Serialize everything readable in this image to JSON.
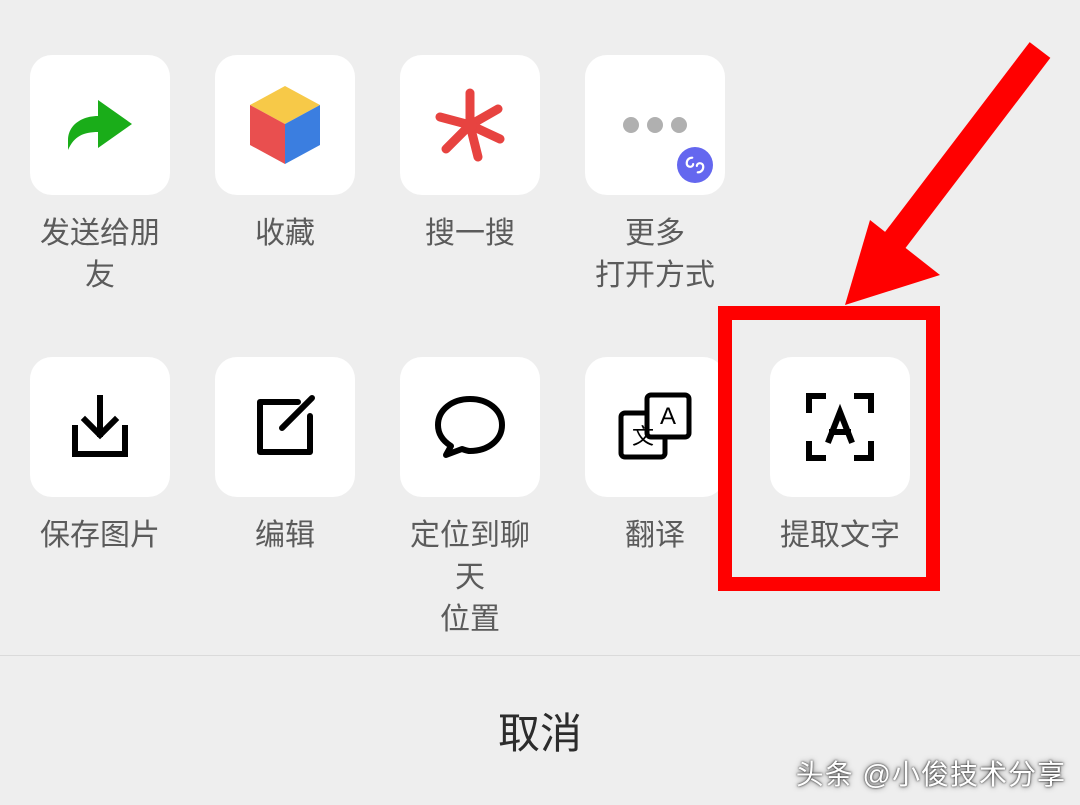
{
  "row1": [
    {
      "id": "send-to-friend",
      "label": "发送给朋友",
      "icon": "share"
    },
    {
      "id": "favorite",
      "label": "收藏",
      "icon": "cube"
    },
    {
      "id": "search",
      "label": "搜一搜",
      "icon": "spark"
    },
    {
      "id": "more-open",
      "label": "更多\n打开方式",
      "icon": "more"
    }
  ],
  "row2": [
    {
      "id": "save-image",
      "label": "保存图片",
      "icon": "download"
    },
    {
      "id": "edit",
      "label": "编辑",
      "icon": "edit"
    },
    {
      "id": "locate-chat",
      "label": "定位到聊天\n位置",
      "icon": "chat"
    },
    {
      "id": "translate",
      "label": "翻译",
      "icon": "translate"
    },
    {
      "id": "extract-text",
      "label": "提取文字",
      "icon": "ocr"
    }
  ],
  "cancel_label": "取消",
  "watermark_text": "头条 @小俊技术分享",
  "colors": {
    "accent_green": "#1aad19",
    "cube_red": "#e94f4f",
    "cube_blue": "#3b7ee0",
    "cube_yellow": "#f7c948",
    "spark_red": "#e74340",
    "badge_purple": "#6467ef",
    "highlight_red": "#ff0000"
  }
}
